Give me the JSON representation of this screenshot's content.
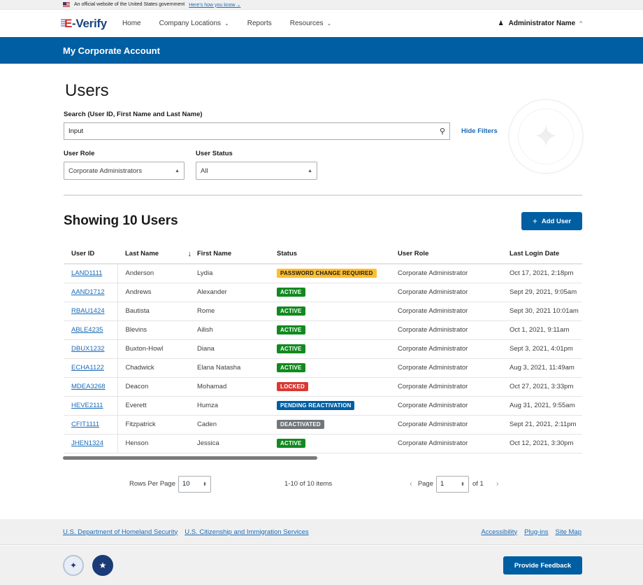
{
  "gov_banner": {
    "text": "An official website of the United States government",
    "link": "Here's how you know",
    "link_chevron": "⌄"
  },
  "header": {
    "logo_e": "E",
    "logo_dash": "-",
    "logo_verify": "Verify",
    "nav": [
      {
        "label": "Home",
        "has_dropdown": false
      },
      {
        "label": "Company Locations",
        "has_dropdown": true
      },
      {
        "label": "Reports",
        "has_dropdown": false
      },
      {
        "label": "Resources",
        "has_dropdown": true
      }
    ],
    "user_icon": "person-icon",
    "user_name": "Administrator Name",
    "chevron_down": "⌄",
    "chevron_up": "^"
  },
  "account_bar": {
    "title": "My Corporate Account"
  },
  "page": {
    "title": "Users",
    "search": {
      "label": "Search (User ID, First Name and Last Name)",
      "value": "Input",
      "icon": "search-icon"
    },
    "hide_filters": "Hide Filters",
    "filters": {
      "role_label": "User Role",
      "role_value": "Corporate Administrators",
      "status_label": "User Status",
      "status_value": "All"
    },
    "showing": "Showing 10 Users",
    "add_user": "Add User",
    "add_user_icon": "+"
  },
  "table": {
    "columns": [
      "User ID",
      "Last Name",
      "First Name",
      "Status",
      "User Role",
      "Last Login Date"
    ],
    "sort_icon": "↓",
    "rows": [
      {
        "id": "LAND1111",
        "last": "Anderson",
        "first": "Lydia",
        "status": "PASSWORD CHANGE REQUIRED",
        "status_type": "pcr",
        "role": "Corporate Administrator",
        "login": "Oct 17, 2021, 2:18pm"
      },
      {
        "id": "AAND1712",
        "last": "Andrews",
        "first": "Alexander",
        "status": "ACTIVE",
        "status_type": "active",
        "role": "Corporate Administrator",
        "login": "Sept 29, 2021, 9:05am"
      },
      {
        "id": "RBAU1424",
        "last": "Bautista",
        "first": "Rome",
        "status": "ACTIVE",
        "status_type": "active",
        "role": "Corporate Administrator",
        "login": "Sept 30, 2021 10:01am"
      },
      {
        "id": "ABLE4235",
        "last": "Blevins",
        "first": "Ailish",
        "status": "ACTIVE",
        "status_type": "active",
        "role": "Corporate Administrator",
        "login": "Oct 1, 2021, 9:11am"
      },
      {
        "id": "DBUX1232",
        "last": "Buxton-Howl",
        "first": "Diana",
        "status": "ACTIVE",
        "status_type": "active",
        "role": "Corporate Administrator",
        "login": "Sept 3, 2021, 4:01pm"
      },
      {
        "id": "ECHA1122",
        "last": "Chadwick",
        "first": "Elana Natasha",
        "status": "ACTIVE",
        "status_type": "active",
        "role": "Corporate Administrator",
        "login": "Aug 3, 2021, 11:49am"
      },
      {
        "id": "MDEA3268",
        "last": "Deacon",
        "first": "Mohamad",
        "status": "LOCKED",
        "status_type": "locked",
        "role": "Corporate Administrator",
        "login": "Oct 27, 2021, 3:33pm"
      },
      {
        "id": "HEVE2111",
        "last": "Everett",
        "first": "Humza",
        "status": "PENDING REACTIVATION",
        "status_type": "pending",
        "role": "Corporate Administrator",
        "login": "Aug 31, 2021, 9:55am"
      },
      {
        "id": "CFIT1111",
        "last": "Fitzpatrick",
        "first": "Caden",
        "status": "DEACTIVATED",
        "status_type": "deactivated",
        "role": "Corporate Administrator",
        "login": "Sept 21, 2021, 2:11pm"
      },
      {
        "id": "JHEN1324",
        "last": "Henson",
        "first": "Jessica",
        "status": "ACTIVE",
        "status_type": "active",
        "role": "Corporate Administrator",
        "login": "Oct 12, 2021, 3:30pm"
      }
    ]
  },
  "pagination": {
    "rows_per_page_label": "Rows Per Page",
    "rows_per_page_value": "10",
    "items_summary": "1-10 of 10 items",
    "prev_icon": "‹",
    "page_label": "Page",
    "page_value": "1",
    "of_label": "of 1",
    "next_icon": "›",
    "updown_icon": "⬍"
  },
  "footer": {
    "left_links": [
      "U.S. Department of Homeland Security",
      "U.S. Citizenship and Immigration Services"
    ],
    "right_links": [
      "Accessibility",
      "Plug-ins",
      "Site Map"
    ],
    "feedback": "Provide Feedback"
  },
  "colors": {
    "primary": "#005ea2",
    "link": "#1a6bb8",
    "active": "#118a1f",
    "locked": "#d83933",
    "pending": "#005ea2",
    "deactivated": "#71767a",
    "warning": "#ffbe2e"
  }
}
